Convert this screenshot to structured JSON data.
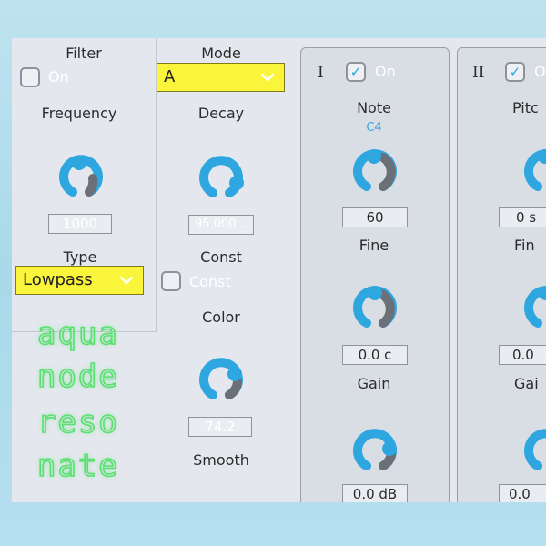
{
  "colors": {
    "accent": "#2ea6e0",
    "knob_track": "#6b6f78",
    "dropdown": "#faf53a",
    "panel": "#e4e8ee",
    "logo_glow": "#59e070"
  },
  "icons": {
    "knob": "rotary-knob-icon",
    "check": "checkmark-icon",
    "chevron": "chevron-down-icon"
  },
  "filter": {
    "title": "Filter",
    "on_label": "On",
    "on_checked": false,
    "frequency_label": "Frequency",
    "frequency_value": "1000",
    "type_label": "Type",
    "type_selected": "Lowpass"
  },
  "mode": {
    "label": "Mode",
    "selected": "A",
    "decay_label": "Decay",
    "decay_value": "95.000...",
    "const_label": "Const",
    "const_check_label": "Const",
    "const_checked": false,
    "color_label": "Color",
    "color_value": "74.2",
    "smooth_label": "Smooth"
  },
  "osc1": {
    "numeral": "I",
    "on_label": "On",
    "on_checked": true,
    "note_label": "Note",
    "note_value": "C4",
    "note_knob_value": "60",
    "fine_label": "Fine",
    "fine_value": "0.0 c",
    "gain_label": "Gain",
    "gain_value": "0.0 dB"
  },
  "osc2": {
    "numeral": "II",
    "on_label": "O",
    "on_checked": true,
    "pitch_label": "Pitc",
    "pitch_value": "0 s",
    "fine_label": "Fin",
    "fine_value": "0.0",
    "gain_label": "Gai",
    "gain_value": "0.0"
  },
  "logo": {
    "line1": "aqua",
    "line2": "node",
    "line3": "reso",
    "line4": "nate"
  }
}
